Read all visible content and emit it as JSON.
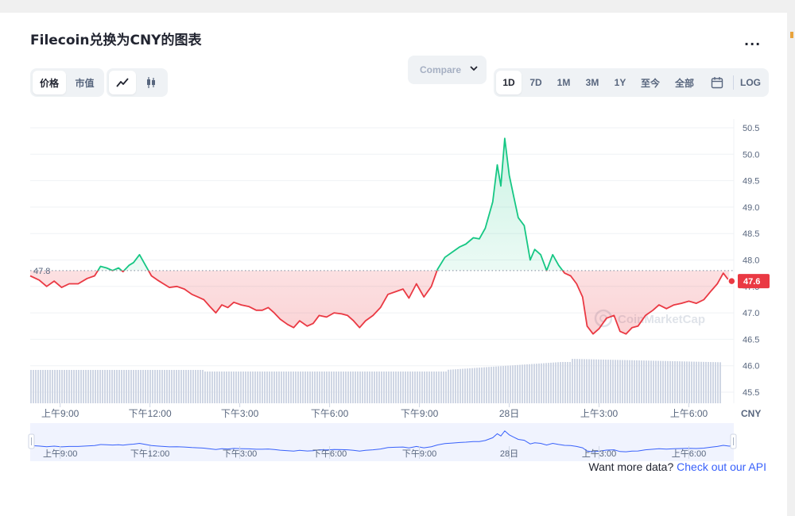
{
  "title": "Filecoin兑换为CNY的图表",
  "more_label": "...",
  "view_tabs": [
    {
      "label": "价格",
      "active": true
    },
    {
      "label": "市值",
      "active": false
    }
  ],
  "chart_type_icons": [
    {
      "icon": "line-chart-icon",
      "active": true
    },
    {
      "icon": "candlestick-icon",
      "active": false
    }
  ],
  "compare_label": "Compare ",
  "range_tabs": [
    {
      "label": "1D",
      "active": true
    },
    {
      "label": "7D",
      "active": false
    },
    {
      "label": "1M",
      "active": false
    },
    {
      "label": "3M",
      "active": false
    },
    {
      "label": "1Y",
      "active": false
    },
    {
      "label": "至今",
      "active": false
    },
    {
      "label": "全部",
      "active": false
    }
  ],
  "log_label": "LOG",
  "watermark": "CoinMarketCap",
  "footer": {
    "text": "Want more data?",
    "link": "Check out our API"
  },
  "colors": {
    "up": "#16c784",
    "down": "#ea3943",
    "navigator": "#3861fb",
    "volume": "#cfd6e4"
  },
  "chart_data": {
    "type": "line",
    "currency": "CNY",
    "reference_value": 47.8,
    "reference_label": "47.8",
    "current_value": 47.6,
    "current_label": "47.6",
    "ylim": [
      45.35,
      50.7
    ],
    "y_ticks": [
      "45.5",
      "46.0",
      "46.5",
      "47.0",
      "47.5",
      "48.0",
      "48.5",
      "49.0",
      "49.5",
      "50.0",
      "50.5"
    ],
    "x_ticks": [
      {
        "t": 1,
        "label": "上午9:00"
      },
      {
        "t": 4,
        "label": "下午12:00"
      },
      {
        "t": 7,
        "label": "下午3:00"
      },
      {
        "t": 10,
        "label": "下午6:00"
      },
      {
        "t": 13,
        "label": "下午9:00"
      },
      {
        "t": 16,
        "label": "28日"
      },
      {
        "t": 19,
        "label": "上午3:00"
      },
      {
        "t": 22,
        "label": "上午6:00"
      }
    ],
    "x_range": [
      0,
      23.5
    ],
    "grid": true,
    "price_points": [
      [
        0,
        47.7
      ],
      [
        0.3,
        47.62
      ],
      [
        0.55,
        47.5
      ],
      [
        0.8,
        47.6
      ],
      [
        1.05,
        47.48
      ],
      [
        1.3,
        47.55
      ],
      [
        1.6,
        47.55
      ],
      [
        1.9,
        47.65
      ],
      [
        2.15,
        47.7
      ],
      [
        2.35,
        47.88
      ],
      [
        2.55,
        47.85
      ],
      [
        2.75,
        47.8
      ],
      [
        2.95,
        47.85
      ],
      [
        3.1,
        47.78
      ],
      [
        3.3,
        47.9
      ],
      [
        3.45,
        47.95
      ],
      [
        3.65,
        48.1
      ],
      [
        3.85,
        47.9
      ],
      [
        4.05,
        47.7
      ],
      [
        4.25,
        47.62
      ],
      [
        4.45,
        47.55
      ],
      [
        4.65,
        47.48
      ],
      [
        4.9,
        47.5
      ],
      [
        5.15,
        47.45
      ],
      [
        5.4,
        47.35
      ],
      [
        5.6,
        47.3
      ],
      [
        5.8,
        47.25
      ],
      [
        6.0,
        47.12
      ],
      [
        6.2,
        47.0
      ],
      [
        6.4,
        47.15
      ],
      [
        6.6,
        47.1
      ],
      [
        6.8,
        47.2
      ],
      [
        7.05,
        47.15
      ],
      [
        7.3,
        47.12
      ],
      [
        7.55,
        47.05
      ],
      [
        7.75,
        47.05
      ],
      [
        7.95,
        47.1
      ],
      [
        8.15,
        47.0
      ],
      [
        8.35,
        46.88
      ],
      [
        8.6,
        46.78
      ],
      [
        8.8,
        46.72
      ],
      [
        9.0,
        46.85
      ],
      [
        9.25,
        46.75
      ],
      [
        9.45,
        46.8
      ],
      [
        9.65,
        46.95
      ],
      [
        9.9,
        46.92
      ],
      [
        10.15,
        47.0
      ],
      [
        10.4,
        46.98
      ],
      [
        10.6,
        46.95
      ],
      [
        10.8,
        46.85
      ],
      [
        11.0,
        46.72
      ],
      [
        11.2,
        46.85
      ],
      [
        11.45,
        46.95
      ],
      [
        11.7,
        47.1
      ],
      [
        11.95,
        47.35
      ],
      [
        12.2,
        47.4
      ],
      [
        12.45,
        47.45
      ],
      [
        12.65,
        47.28
      ],
      [
        12.9,
        47.55
      ],
      [
        13.15,
        47.3
      ],
      [
        13.4,
        47.5
      ],
      [
        13.6,
        47.82
      ],
      [
        13.85,
        48.05
      ],
      [
        14.1,
        48.15
      ],
      [
        14.35,
        48.25
      ],
      [
        14.55,
        48.3
      ],
      [
        14.8,
        48.42
      ],
      [
        15.0,
        48.4
      ],
      [
        15.2,
        48.6
      ],
      [
        15.45,
        49.1
      ],
      [
        15.6,
        49.8
      ],
      [
        15.72,
        49.4
      ],
      [
        15.85,
        50.3
      ],
      [
        16.0,
        49.6
      ],
      [
        16.15,
        49.2
      ],
      [
        16.3,
        48.8
      ],
      [
        16.5,
        48.65
      ],
      [
        16.7,
        48.0
      ],
      [
        16.85,
        48.2
      ],
      [
        17.05,
        48.1
      ],
      [
        17.25,
        47.8
      ],
      [
        17.45,
        48.1
      ],
      [
        17.65,
        47.9
      ],
      [
        17.85,
        47.75
      ],
      [
        18.05,
        47.7
      ],
      [
        18.25,
        47.55
      ],
      [
        18.45,
        47.3
      ],
      [
        18.6,
        46.75
      ],
      [
        18.8,
        46.6
      ],
      [
        19.0,
        46.7
      ],
      [
        19.25,
        46.9
      ],
      [
        19.5,
        46.95
      ],
      [
        19.7,
        46.65
      ],
      [
        19.9,
        46.6
      ],
      [
        20.1,
        46.72
      ],
      [
        20.3,
        46.75
      ],
      [
        20.55,
        46.95
      ],
      [
        20.8,
        47.05
      ],
      [
        21.0,
        47.15
      ],
      [
        21.25,
        47.08
      ],
      [
        21.5,
        47.15
      ],
      [
        21.75,
        47.18
      ],
      [
        22.0,
        47.22
      ],
      [
        22.25,
        47.18
      ],
      [
        22.5,
        47.25
      ],
      [
        22.75,
        47.42
      ],
      [
        22.95,
        47.55
      ],
      [
        23.15,
        47.75
      ],
      [
        23.35,
        47.6
      ]
    ],
    "navigator_labels": [
      "上午9:00",
      "下午12:00",
      "下午3:00",
      "下午6:00",
      "下午9:00",
      "28日",
      "上午3:00",
      "上午6:00"
    ]
  }
}
